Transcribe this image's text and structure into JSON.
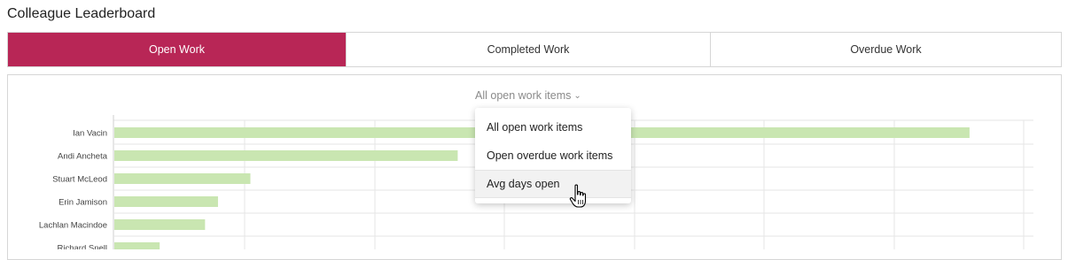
{
  "page": {
    "title": "Colleague Leaderboard"
  },
  "tabs": [
    {
      "label": "Open Work",
      "active": true
    },
    {
      "label": "Completed Work",
      "active": false
    },
    {
      "label": "Overdue Work",
      "active": false
    }
  ],
  "filter": {
    "selected": "All open work items",
    "options": [
      "All open work items",
      "Open overdue work items",
      "Avg days open"
    ],
    "hovered": "Avg days open"
  },
  "colors": {
    "accent": "#b82656",
    "bar": "#c9e6b1",
    "grid": "#e6e6e6"
  },
  "cursor_icon": "hand-pointer-icon",
  "chart_data": {
    "type": "bar",
    "orientation": "horizontal",
    "categories": [
      "Ian Vacin",
      "Andi Ancheta",
      "Stuart McLeod",
      "Erin Jamison",
      "Lachlan Macindoe",
      "Richard Snell"
    ],
    "values": [
      66,
      26.5,
      10.5,
      8,
      7,
      3.5
    ],
    "xlim": [
      0,
      71
    ],
    "grid": true,
    "xlabel": "",
    "ylabel": "",
    "title": ""
  }
}
